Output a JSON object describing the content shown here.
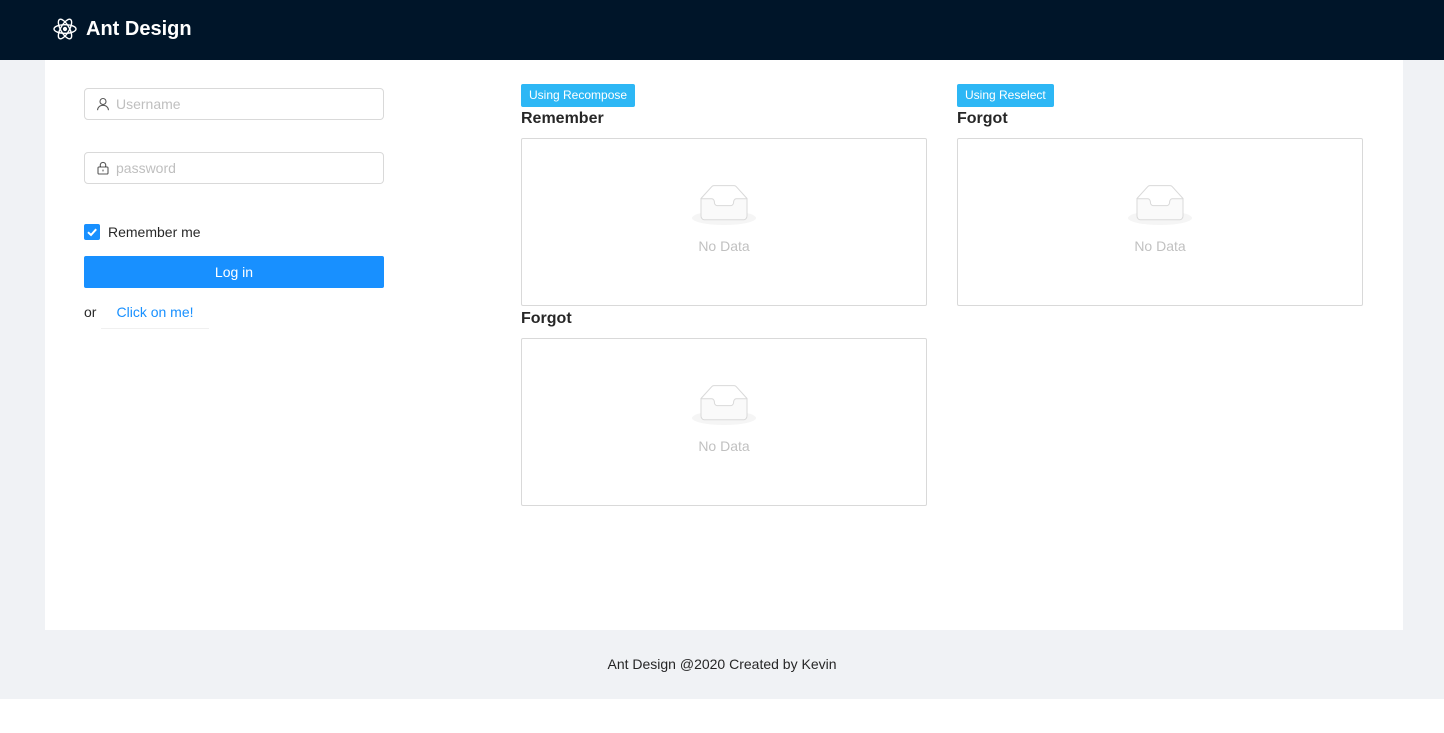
{
  "header": {
    "logo_icon": "react-atom-icon",
    "title": "Ant Design"
  },
  "login_form": {
    "username": {
      "placeholder": "Username",
      "value": "",
      "icon": "user-icon"
    },
    "password": {
      "placeholder": "password",
      "value": "",
      "icon": "lock-icon"
    },
    "remember": {
      "label": "Remember me",
      "checked": true
    },
    "login_label": "Log in",
    "or_text": "or",
    "link_label": "Click on me!"
  },
  "panels": {
    "recompose": {
      "tag": "Using Recompose",
      "remember_title": "Remember",
      "remember_empty": "No Data",
      "forgot_title": "Forgot",
      "forgot_empty": "No Data"
    },
    "reselect": {
      "tag": "Using Reselect",
      "forgot_title": "Forgot",
      "forgot_empty": "No Data"
    }
  },
  "footer": {
    "text": "Ant Design @2020 Created by Kevin"
  },
  "colors": {
    "header_bg": "#001529",
    "primary": "#1890ff",
    "tag": "#2db7f5",
    "layout_bg": "#f0f2f5"
  }
}
